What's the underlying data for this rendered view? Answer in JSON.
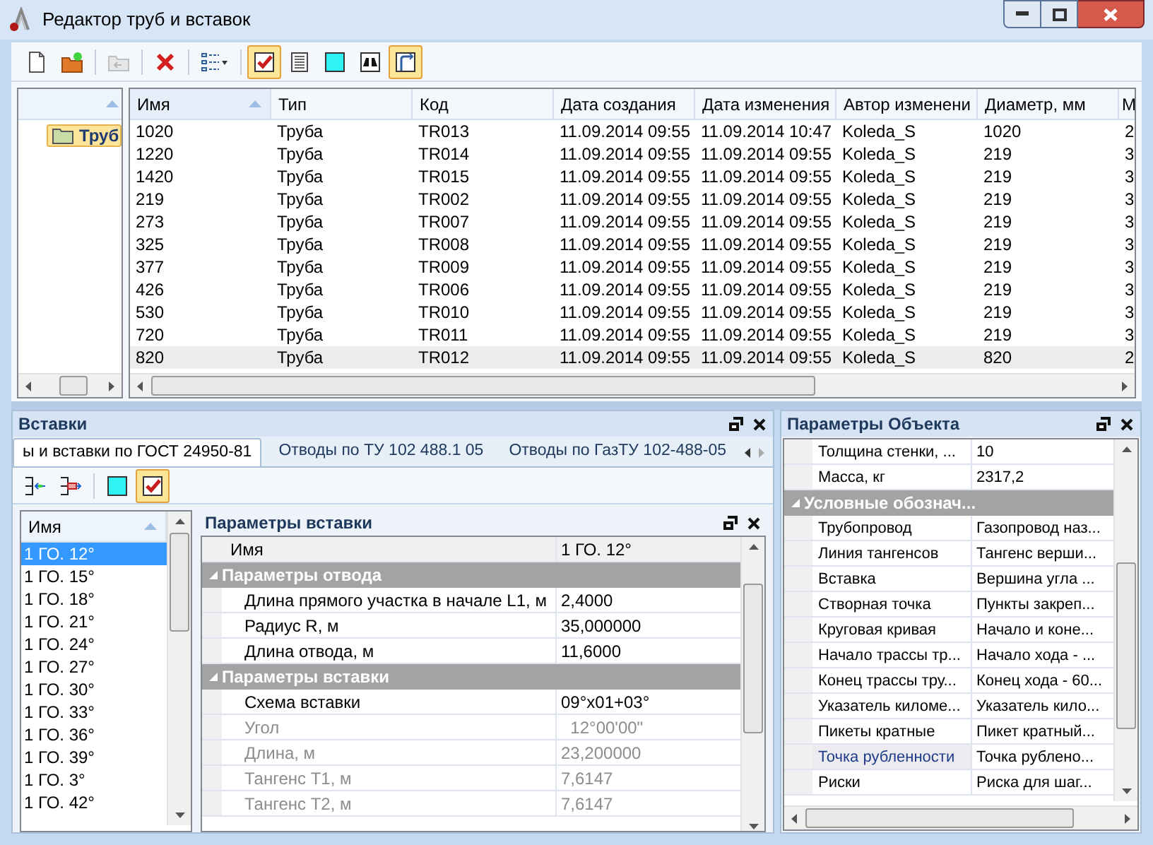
{
  "window": {
    "title": "Редактор труб и вставок"
  },
  "toolbar": [
    {
      "kind": "new-doc",
      "pressed": false,
      "disabled": false
    },
    {
      "kind": "folder-star",
      "pressed": false,
      "disabled": false
    },
    {
      "kind": "sep"
    },
    {
      "kind": "folder-up",
      "pressed": false,
      "disabled": true
    },
    {
      "kind": "sep"
    },
    {
      "kind": "delete",
      "pressed": false,
      "disabled": false
    },
    {
      "kind": "sep"
    },
    {
      "kind": "list-menu",
      "pressed": false,
      "disabled": false
    },
    {
      "kind": "sep"
    },
    {
      "kind": "check",
      "pressed": true,
      "disabled": false
    },
    {
      "kind": "text-doc",
      "pressed": false,
      "disabled": false
    },
    {
      "kind": "square",
      "pressed": false,
      "disabled": false
    },
    {
      "kind": "binoculars",
      "pressed": false,
      "disabled": false
    },
    {
      "kind": "connector",
      "pressed": true,
      "disabled": false
    }
  ],
  "tree": {
    "sorted": true,
    "items": [
      {
        "label": "Труб",
        "selected": true
      }
    ]
  },
  "grid": {
    "columns": [
      {
        "label": "Имя",
        "sorted": true
      },
      {
        "label": "Тип",
        "sorted": false
      },
      {
        "label": "Код",
        "sorted": false
      },
      {
        "label": "Дата создания",
        "sorted": false
      },
      {
        "label": "Дата изменения",
        "sorted": false
      },
      {
        "label": "Автор изменени",
        "sorted": false
      },
      {
        "label": "Диаметр, мм",
        "sorted": false
      },
      {
        "label": "М",
        "sorted": false
      }
    ],
    "rows": [
      {
        "cells": [
          "1020",
          "Труба",
          "TR013",
          "11.09.2014 09:55",
          "11.09.2014 10:47",
          "Koleda_S",
          "1020",
          "2"
        ],
        "selected": false
      },
      {
        "cells": [
          "1220",
          "Труба",
          "TR014",
          "11.09.2014 09:55",
          "11.09.2014 09:55",
          "Koleda_S",
          "219",
          "3"
        ],
        "selected": false
      },
      {
        "cells": [
          "1420",
          "Труба",
          "TR015",
          "11.09.2014 09:55",
          "11.09.2014 09:55",
          "Koleda_S",
          "219",
          "3"
        ],
        "selected": false
      },
      {
        "cells": [
          "219",
          "Труба",
          "TR002",
          "11.09.2014 09:55",
          "11.09.2014 09:55",
          "Koleda_S",
          "219",
          "3"
        ],
        "selected": false
      },
      {
        "cells": [
          "273",
          "Труба",
          "TR007",
          "11.09.2014 09:55",
          "11.09.2014 09:55",
          "Koleda_S",
          "219",
          "3"
        ],
        "selected": false
      },
      {
        "cells": [
          "325",
          "Труба",
          "TR008",
          "11.09.2014 09:55",
          "11.09.2014 09:55",
          "Koleda_S",
          "219",
          "3"
        ],
        "selected": false
      },
      {
        "cells": [
          "377",
          "Труба",
          "TR009",
          "11.09.2014 09:55",
          "11.09.2014 09:55",
          "Koleda_S",
          "219",
          "3"
        ],
        "selected": false
      },
      {
        "cells": [
          "426",
          "Труба",
          "TR006",
          "11.09.2014 09:55",
          "11.09.2014 09:55",
          "Koleda_S",
          "219",
          "3"
        ],
        "selected": false
      },
      {
        "cells": [
          "530",
          "Труба",
          "TR010",
          "11.09.2014 09:55",
          "11.09.2014 09:55",
          "Koleda_S",
          "219",
          "3"
        ],
        "selected": false
      },
      {
        "cells": [
          "720",
          "Труба",
          "TR011",
          "11.09.2014 09:55",
          "11.09.2014 09:55",
          "Koleda_S",
          "219",
          "3"
        ],
        "selected": false
      },
      {
        "cells": [
          "820",
          "Труба",
          "TR012",
          "11.09.2014 09:55",
          "11.09.2014 09:55",
          "Koleda_S",
          "820",
          "2"
        ],
        "selected": true
      }
    ]
  },
  "inserts_panel": {
    "title": "Вставки",
    "tabs": [
      {
        "label": "ы и вставки по ГОСТ 24950-81",
        "selected": true
      },
      {
        "label": "Отводы по ТУ 102 488.1 05",
        "selected": false
      },
      {
        "label": "Отводы по ГазТУ 102-488-05",
        "selected": false
      }
    ],
    "toolbar": [
      {
        "kind": "insert-left",
        "pressed": false,
        "disabled": false
      },
      {
        "kind": "insert-right",
        "pressed": false,
        "disabled": false
      },
      {
        "kind": "sep"
      },
      {
        "kind": "square",
        "pressed": false,
        "disabled": false
      },
      {
        "kind": "check",
        "pressed": true,
        "disabled": false
      }
    ],
    "list": {
      "header": "Имя",
      "sorted": true,
      "items": [
        {
          "label": "1 ГО. 12°",
          "selected": true
        },
        {
          "label": "1 ГО. 15°",
          "selected": false
        },
        {
          "label": "1 ГО. 18°",
          "selected": false
        },
        {
          "label": "1 ГО. 21°",
          "selected": false
        },
        {
          "label": "1 ГО. 24°",
          "selected": false
        },
        {
          "label": "1 ГО. 27°",
          "selected": false
        },
        {
          "label": "1 ГО. 30°",
          "selected": false
        },
        {
          "label": "1 ГО. 33°",
          "selected": false
        },
        {
          "label": "1 ГО. 36°",
          "selected": false
        },
        {
          "label": "1 ГО. 39°",
          "selected": false
        },
        {
          "label": "1 ГО. 3°",
          "selected": false
        },
        {
          "label": "1 ГО. 42°",
          "selected": false
        }
      ]
    },
    "params": {
      "title": "Параметры вставки",
      "rows": [
        {
          "kind": "property",
          "name": "Имя",
          "value": "1 ГО. 12°",
          "disabled": false,
          "indented": false
        },
        {
          "kind": "category",
          "name": "Параметры отвода",
          "expanded": true
        },
        {
          "kind": "property",
          "name": "Длина прямого участка в начале L1, м",
          "value": "2,4000",
          "disabled": false,
          "indented": true
        },
        {
          "kind": "property",
          "name": "Радиус R, м",
          "value": "35,000000",
          "disabled": false,
          "indented": true
        },
        {
          "kind": "property",
          "name": "Длина отвода, м",
          "value": "11,6000",
          "disabled": false,
          "indented": true
        },
        {
          "kind": "category",
          "name": "Параметры вставки",
          "expanded": true
        },
        {
          "kind": "property",
          "name": "Схема вставки",
          "value": "09°x01+03°",
          "disabled": false,
          "indented": true
        },
        {
          "kind": "property",
          "name": "Угол",
          "value": "  12°00'00\"",
          "disabled": true,
          "indented": true
        },
        {
          "kind": "property",
          "name": "Длина, м",
          "value": "23,200000",
          "disabled": true,
          "indented": true
        },
        {
          "kind": "property",
          "name": "Тангенс T1, м",
          "value": "7,6147",
          "disabled": true,
          "indented": true
        },
        {
          "kind": "property",
          "name": "Тангенс T2, м",
          "value": "7,6147",
          "disabled": true,
          "indented": true
        }
      ]
    }
  },
  "object_panel": {
    "title": "Параметры Объекта",
    "rows": [
      {
        "kind": "property",
        "name": "Толщина стенки, ...",
        "value": "10",
        "selected": false
      },
      {
        "kind": "property",
        "name": "Масса, кг",
        "value": "2317,2",
        "selected": false
      },
      {
        "kind": "category",
        "name": "Условные обознач...",
        "expanded": true
      },
      {
        "kind": "property",
        "name": "Трубопровод",
        "value": "Газопровод наз...",
        "selected": false
      },
      {
        "kind": "property",
        "name": "Линия тангенсов",
        "value": "Тангенс верши...",
        "selected": false
      },
      {
        "kind": "property",
        "name": "Вставка",
        "value": "Вершина угла ...",
        "selected": false
      },
      {
        "kind": "property",
        "name": "Створная точка",
        "value": "Пункты закреп...",
        "selected": false
      },
      {
        "kind": "property",
        "name": "Круговая кривая",
        "value": "Начало и коне...",
        "selected": false
      },
      {
        "kind": "property",
        "name": "Начало трассы тр...",
        "value": "Начало хода - ...",
        "selected": false
      },
      {
        "kind": "property",
        "name": "Конец трассы тру...",
        "value": "Конец хода - 60...",
        "selected": false
      },
      {
        "kind": "property",
        "name": "Указатель киломе...",
        "value": "Указатель кило...",
        "selected": false
      },
      {
        "kind": "property",
        "name": "Пикеты кратные",
        "value": "Пикет кратный...",
        "selected": false
      },
      {
        "kind": "property",
        "name": "Точка рубленности",
        "value": "Точка рублено...",
        "selected": true
      },
      {
        "kind": "property",
        "name": "Риски",
        "value": "Риска для шаг...",
        "selected": false
      }
    ]
  }
}
